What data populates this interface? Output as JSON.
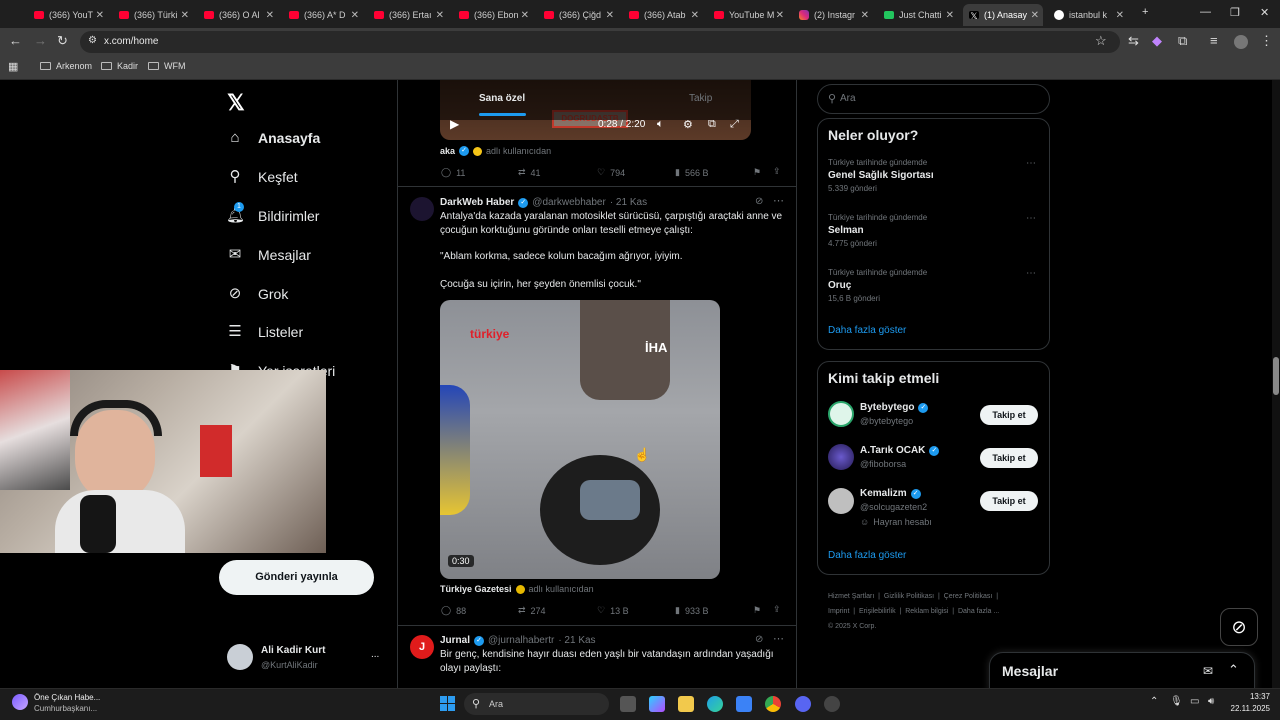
{
  "browser": {
    "tabs": [
      {
        "label": "(366) YouT",
        "icon": "youtube-icon"
      },
      {
        "label": "(366) Türki",
        "icon": "youtube-icon"
      },
      {
        "label": "(366) O Al",
        "icon": "youtube-icon"
      },
      {
        "label": "(366) A* D",
        "icon": "youtube-icon"
      },
      {
        "label": "(366) Ertaı",
        "icon": "youtube-icon"
      },
      {
        "label": "(366) Ebon",
        "icon": "youtube-icon"
      },
      {
        "label": "(366) Çiğd",
        "icon": "youtube-icon"
      },
      {
        "label": "(366) Atab",
        "icon": "youtube-icon"
      },
      {
        "label": "YouTube M",
        "icon": "youtube-music-icon"
      },
      {
        "label": "(2) Instagr",
        "icon": "instagram-icon"
      },
      {
        "label": "Just Chatti",
        "icon": "just-chatting-icon"
      },
      {
        "label": "(1) Anasay",
        "icon": "x-icon"
      },
      {
        "label": "istanbul k",
        "icon": "google-icon"
      }
    ],
    "url": "x.com/home",
    "bookmarks": [
      "Arkenom",
      "Kadir",
      "WFM"
    ]
  },
  "sidebar": {
    "items": [
      {
        "label": "Anasayfa",
        "icon": "home-icon"
      },
      {
        "label": "Keşfet",
        "icon": "search-icon"
      },
      {
        "label": "Bildirimler",
        "icon": "bell-icon",
        "badge": "1"
      },
      {
        "label": "Mesajlar",
        "icon": "mail-icon"
      },
      {
        "label": "Grok",
        "icon": "grok-icon"
      },
      {
        "label": "Listeler",
        "icon": "list-icon"
      },
      {
        "label": "Yer işaretleri",
        "icon": "bookmark-icon"
      }
    ],
    "post_button": "Gönderi yayınla",
    "account": {
      "name": "Ali Kadir Kurt",
      "handle": "@KurtAliKadir",
      "more": "..."
    }
  },
  "feed": {
    "tabs": [
      "Sana özel",
      "Takip"
    ],
    "video1": {
      "time": "0:28 / 2:20",
      "watermark": "DOGRUDASTB",
      "attribution_name": "aka",
      "attribution_note": "adlı kullanıcıdan",
      "stats": {
        "replies": "11",
        "reposts": "41",
        "likes": "794",
        "views": "566 B"
      }
    },
    "tweet2": {
      "name": "DarkWeb Haber",
      "handle": "@darkwebhaber",
      "time": "· 21 Kas",
      "text1": "Antalya'da kazada yaralanan motosiklet sürücüsü, çarpıştığı araçtaki anne ve çocuğun korktuğunu göründe onları teselli etmeye çalıştı:",
      "text2": "\"Ablam korkma, sadece kolum bacağım ağrıyor, iyiyim.",
      "text3": "Çocuğa su içirin, her şeyden önemlisi çocuk.\"",
      "video_logo_left": "türkiye",
      "video_logo_right": "İHA",
      "video_duration": "0:30",
      "attribution_name": "Türkiye Gazetesi",
      "attribution_note": "adlı kullanıcıdan",
      "stats": {
        "replies": "88",
        "reposts": "274",
        "likes": "13 B",
        "views": "933 B"
      }
    },
    "tweet3": {
      "name": "Jurnal",
      "handle": "@jurnalhabertr",
      "time": "· 21 Kas",
      "text": "Bir genç, kendisine hayır duası eden yaşlı bir vatandaşın ardından yaşadığı olayı paylaştı:"
    }
  },
  "right": {
    "search_placeholder": "Ara",
    "trends_title": "Neler oluyor?",
    "trends": [
      {
        "category": "Türkiye tarihinde gündemde",
        "name": "Genel Sağlık Sigortası",
        "count": "5.339 gönderi"
      },
      {
        "category": "Türkiye tarihinde gündemde",
        "name": "Selman",
        "count": "4.775 gönderi"
      },
      {
        "category": "Türkiye tarihinde gündemde",
        "name": "Oruç",
        "count": "15,6 B gönderi"
      }
    ],
    "show_more": "Daha fazla göster",
    "who_to_follow_title": "Kimi takip etmeli",
    "who_to_follow": [
      {
        "name": "Bytebytego",
        "handle": "@bytebytego",
        "button": "Takip et"
      },
      {
        "name": "A.Tarık OCAK",
        "handle": "@fiboborsa",
        "button": "Takip et"
      },
      {
        "name": "Kemalizm",
        "handle": "@solcugazeten2",
        "button": "Takip et",
        "note": "Hayran hesabı"
      }
    ],
    "show_more2": "Daha fazla göster",
    "footer": [
      "Hizmet Şartları",
      "Gizlilik Politikası",
      "Çerez Politikası",
      "Imprint",
      "Erişilebilirlik",
      "Reklam bilgisi",
      "Daha fazla ...",
      "© 2025 X Corp."
    ],
    "messages_title": "Mesajlar"
  },
  "taskbar": {
    "news_title": "Öne Çıkan Habe...",
    "news_sub": "Cumhurbaşkanı...",
    "search_placeholder": "Ara",
    "time": "13:37",
    "date": "22.11.2025"
  }
}
